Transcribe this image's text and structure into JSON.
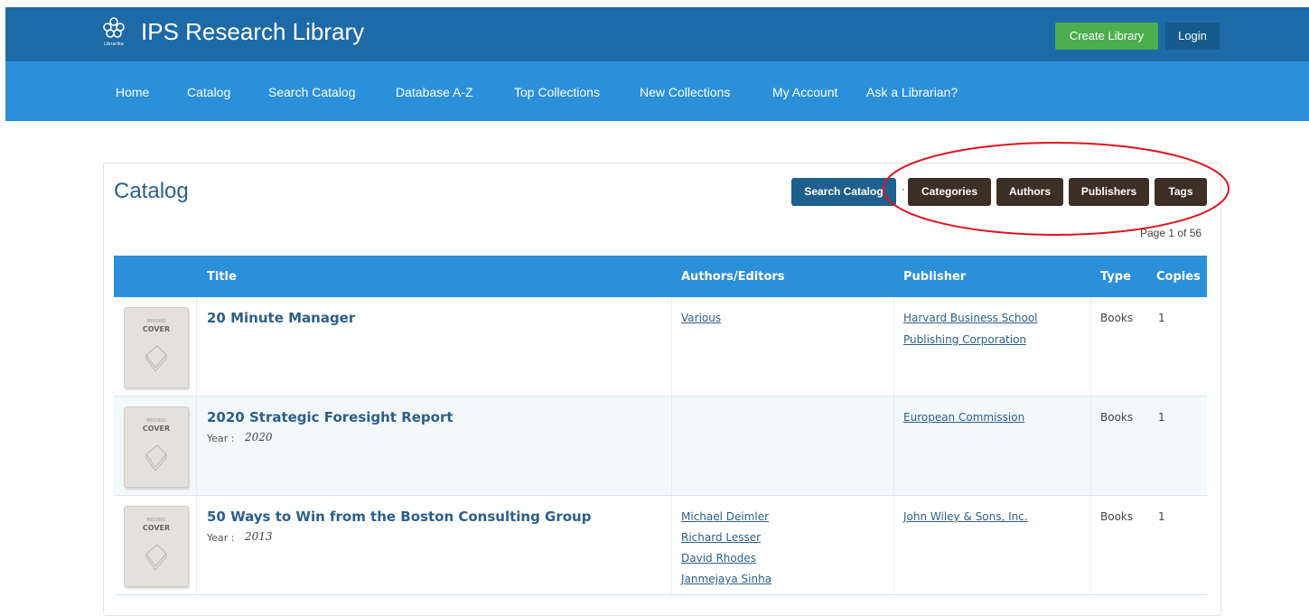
{
  "header": {
    "brand": "IPS Research Library",
    "logo_caption": "Librarika",
    "create_label": "Create Library",
    "login_label": "Login"
  },
  "nav": [
    "Home",
    "Catalog",
    "Search Catalog",
    "Database A-Z",
    "Top Collections",
    "New Collections",
    "My Account",
    "Ask a Librarian?"
  ],
  "catalog": {
    "title": "Catalog",
    "search_label": "Search Catalog",
    "separator": "·",
    "filters": [
      "Categories",
      "Authors",
      "Publishers",
      "Tags"
    ],
    "page_info": "Page 1 of 56"
  },
  "table": {
    "headers": {
      "title": "Title",
      "authors": "Authors/Editors",
      "publisher": "Publisher",
      "type": "Type",
      "copies": "Copies"
    },
    "cover": {
      "small": "MISSING",
      "big": "COVER"
    },
    "year_label": "Year   :",
    "rows": [
      {
        "title": "20 Minute Manager",
        "year": "",
        "authors": [
          "Various"
        ],
        "publisher": [
          "Harvard Business School",
          "Publishing Corporation"
        ],
        "type": "Books",
        "copies": "1"
      },
      {
        "title": "2020 Strategic Foresight Report",
        "year": "2020",
        "authors": [],
        "publisher": [
          "European Commission"
        ],
        "type": "Books",
        "copies": "1"
      },
      {
        "title": "50 Ways to Win from the Boston Consulting Group",
        "year": "2013",
        "authors": [
          "Michael Deimler",
          "Richard Lesser",
          "David Rhodes",
          "Janmejaya Sinha"
        ],
        "publisher": [
          "John Wiley & Sons, Inc."
        ],
        "type": "Books",
        "copies": "1"
      }
    ]
  },
  "colors": {
    "topbar": "#1d6aa6",
    "navbar": "#2b90d9",
    "create": "#4cae4c",
    "filter_button": "#3d2e26",
    "annotation": "#e0141c"
  }
}
